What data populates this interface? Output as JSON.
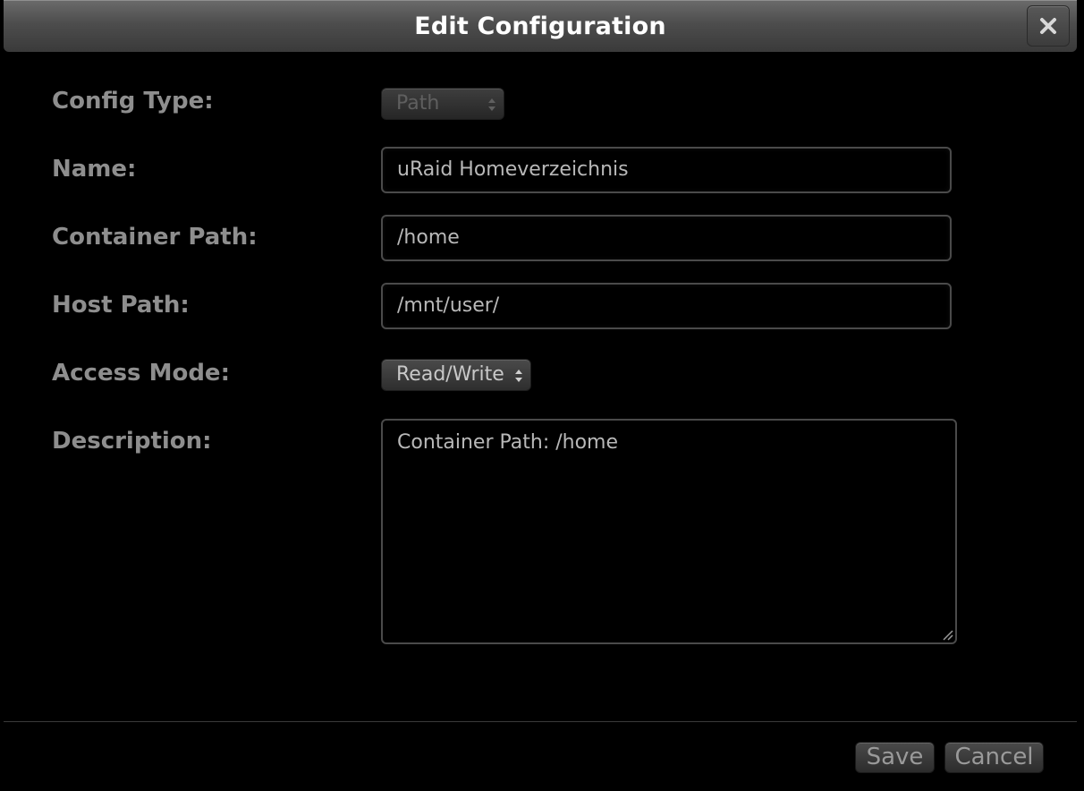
{
  "dialog": {
    "title": "Edit Configuration",
    "close_icon": "close-icon"
  },
  "form": {
    "config_type": {
      "label": "Config Type:",
      "value": "Path"
    },
    "name": {
      "label": "Name:",
      "value": "uRaid Homeverzeichnis"
    },
    "container_path": {
      "label": "Container Path:",
      "value": "/home"
    },
    "host_path": {
      "label": "Host Path:",
      "value": "/mnt/user/"
    },
    "access_mode": {
      "label": "Access Mode:",
      "value": "Read/Write"
    },
    "description": {
      "label": "Description:",
      "value": "Container Path: /home"
    }
  },
  "footer": {
    "save_label": "Save",
    "cancel_label": "Cancel"
  }
}
